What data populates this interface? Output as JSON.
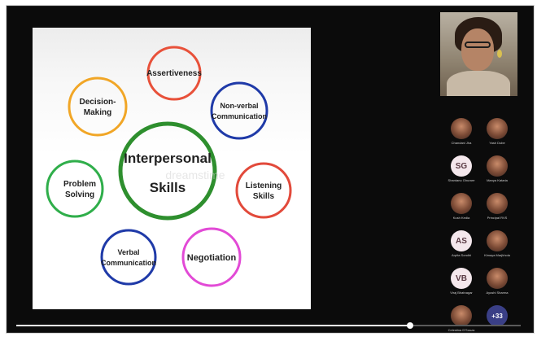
{
  "slide": {
    "center": {
      "line1": "Interpersonal",
      "line2": "Skills"
    },
    "watermark": "dreamstime",
    "skills": [
      {
        "lines": [
          "Assertiveness"
        ],
        "color": "#e8513a"
      },
      {
        "lines": [
          "Non-verbal",
          "Communication"
        ],
        "color": "#1f3aa8"
      },
      {
        "lines": [
          "Listening",
          "Skills"
        ],
        "color": "#e24a3b"
      },
      {
        "lines": [
          "Negotiation"
        ],
        "color": "#e24ad6"
      },
      {
        "lines": [
          "Verbal",
          "Communication"
        ],
        "color": "#1f3aa8"
      },
      {
        "lines": [
          "Problem",
          "Solving"
        ],
        "color": "#2fae4a"
      },
      {
        "lines": [
          "Decision-",
          "Making"
        ],
        "color": "#f1a626"
      }
    ],
    "center_color": "#2e8f2e"
  },
  "participants": [
    {
      "name": "Chandani Jha",
      "type": "photo"
    },
    {
      "name": "Yash Dube",
      "type": "photo"
    },
    {
      "name": "Shantanu Ghurare",
      "type": "initials",
      "initials": "SG"
    },
    {
      "name": "Manya Kataria",
      "type": "photo"
    },
    {
      "name": "Kush Kedia",
      "type": "photo"
    },
    {
      "name": "Principal RVS",
      "type": "photo"
    },
    {
      "name": "Arpita Sondhi",
      "type": "initials",
      "initials": "AS"
    },
    {
      "name": "Kimaya Marjkhola",
      "type": "photo"
    },
    {
      "name": "Viraj Bhatnagar",
      "type": "initials",
      "initials": "VB"
    },
    {
      "name": "Ayushi Sharma",
      "type": "photo"
    },
    {
      "name": "Celestina D'Souza",
      "type": "photo"
    },
    {
      "name": "",
      "type": "more",
      "initials": "+33"
    }
  ],
  "playback": {
    "progress": 0.78
  }
}
